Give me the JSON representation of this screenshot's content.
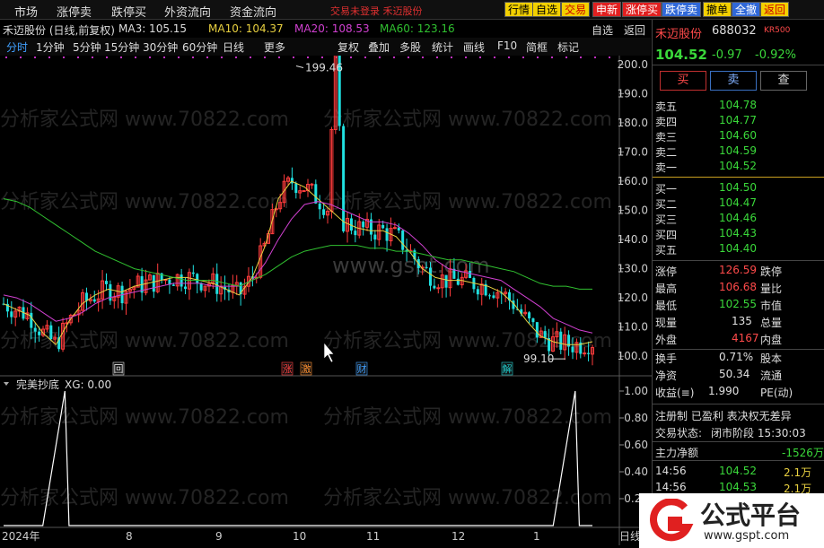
{
  "topbar": {
    "nav": [
      "市场",
      "涨停卖",
      "跌停买",
      "外资流向",
      "资金流向"
    ],
    "alert": "交易未登录  禾迈股份",
    "buttons": [
      {
        "label": "行情",
        "bg": "#f2d000",
        "fg": "#000"
      },
      {
        "label": "自选",
        "bg": "#f2d000",
        "fg": "#000"
      },
      {
        "label": "交易",
        "bg": "#f2d000",
        "fg": "#c00"
      },
      {
        "label": "申新",
        "bg": "#e02020",
        "fg": "#fff"
      },
      {
        "label": "涨停买",
        "bg": "#e02020",
        "fg": "#fff"
      },
      {
        "label": "跌停卖",
        "bg": "#3068d8",
        "fg": "#fff"
      },
      {
        "label": "撤单",
        "bg": "#f2d000",
        "fg": "#000"
      },
      {
        "label": "全撤",
        "bg": "#3068d8",
        "fg": "#fff"
      },
      {
        "label": "返回",
        "bg": "#f2d000",
        "fg": "#c00"
      }
    ]
  },
  "chart_header": {
    "title": "禾迈股份 (日线,前复权)",
    "ma3": "MA3: 105.15",
    "ma10": "MA10: 104.37",
    "ma20": "MA20: 108.53",
    "ma60": "MA60: 123.16",
    "right_tools": [
      "自选",
      "返回"
    ]
  },
  "periods": [
    "分时",
    "1分钟",
    "5分钟",
    "15分钟",
    "30分钟",
    "60分钟",
    "日线",
    "更多"
  ],
  "tools": [
    "复权",
    "叠加",
    "多股",
    "统计",
    "画线",
    "F10",
    "简框",
    "标记"
  ],
  "price_axis": [
    "200.0",
    "190.0",
    "180.0",
    "170.0",
    "160.0",
    "150.0",
    "140.0",
    "130.0",
    "120.0",
    "110.0",
    "100.0"
  ],
  "annotations": {
    "high": "199.46",
    "low": "99.10"
  },
  "event_marks": [
    "回",
    "涨",
    "激",
    "财",
    "解"
  ],
  "indicator": {
    "title": "完美抄底",
    "value": "XG: 0.00",
    "axis": [
      "1.00",
      "0.80",
      "0.60",
      "0.40",
      "0.20"
    ]
  },
  "x_axis": [
    "2024年",
    "8",
    "9",
    "10",
    "11",
    "12",
    "1",
    "日线"
  ],
  "colors": {
    "up": "#ff3c3c",
    "down": "#20e0e0",
    "ma3": "#ffffff",
    "ma10": "#e8d040",
    "ma20": "#d040d0",
    "ma60": "#30c030"
  },
  "chart_data": {
    "type": "line",
    "title": "禾迈股份 (日线,前复权)",
    "xlabel": "",
    "ylabel": "",
    "ylim": [
      97,
      203
    ],
    "x_ticks": [
      "2024年",
      "8",
      "9",
      "10",
      "11",
      "12",
      "1"
    ],
    "series": [
      {
        "name": "MA10",
        "values": [
          118,
          116,
          114,
          108,
          104,
          112,
          118,
          121,
          123,
          122,
          124,
          125,
          126,
          127,
          127,
          126,
          125,
          123,
          121,
          127,
          138,
          154,
          160,
          158,
          154,
          150,
          146,
          144,
          143,
          143,
          141,
          136,
          130,
          127,
          126,
          126,
          125,
          124,
          122,
          118,
          112,
          107,
          105,
          104,
          104,
          105
        ]
      },
      {
        "name": "MA20",
        "values": [
          121,
          120,
          118,
          115,
          112,
          113,
          115,
          118,
          120,
          121,
          122,
          123,
          124,
          125,
          125,
          125,
          124,
          124,
          124,
          126,
          132,
          140,
          147,
          152,
          153,
          152,
          150,
          148,
          146,
          146,
          145,
          142,
          138,
          133,
          130,
          129,
          128,
          127,
          126,
          123,
          120,
          117,
          113,
          111,
          109,
          108
        ]
      },
      {
        "name": "MA60",
        "values": [
          154,
          153,
          151,
          148,
          145,
          142,
          139,
          136,
          134,
          132,
          130,
          129,
          128,
          127,
          126,
          126,
          126,
          125,
          124,
          126,
          128,
          131,
          134,
          136,
          137,
          138,
          138,
          138,
          137,
          137,
          136,
          136,
          135,
          134,
          133,
          133,
          132,
          131,
          130,
          129,
          127,
          125,
          124,
          124,
          123,
          123
        ]
      },
      {
        "name": "完美抄底",
        "values": [
          0,
          0,
          0,
          0,
          1,
          0,
          0,
          0,
          0,
          0,
          0,
          0,
          0,
          0,
          0,
          0,
          0,
          0,
          0,
          0,
          0,
          0,
          0,
          0,
          0,
          0,
          0,
          0,
          0,
          0,
          0,
          0,
          0,
          0,
          0,
          0,
          0,
          0,
          0,
          0,
          0,
          0,
          0,
          1,
          0,
          0
        ]
      }
    ]
  },
  "quote": {
    "name": "禾迈股份",
    "code": "688032",
    "tag": "KR500",
    "price": "104.52",
    "change": "-0.97",
    "pct": "-0.92%",
    "buy": "买",
    "sell": "卖",
    "query": "查",
    "asks": [
      {
        "l": "卖五",
        "p": "104.78"
      },
      {
        "l": "卖四",
        "p": "104.77"
      },
      {
        "l": "卖三",
        "p": "104.60"
      },
      {
        "l": "卖二",
        "p": "104.59"
      },
      {
        "l": "卖一",
        "p": "104.52"
      }
    ],
    "bids": [
      {
        "l": "买一",
        "p": "104.50"
      },
      {
        "l": "买二",
        "p": "104.47"
      },
      {
        "l": "买三",
        "p": "104.46"
      },
      {
        "l": "买四",
        "p": "104.43"
      },
      {
        "l": "买五",
        "p": "104.40"
      }
    ],
    "stats": [
      {
        "l": "涨停",
        "v": "126.59",
        "l2": "跌停",
        "c": "#ff4a4a"
      },
      {
        "l": "最高",
        "v": "106.68",
        "l2": "量比",
        "c": "#ff4a4a"
      },
      {
        "l": "最低",
        "v": "102.55",
        "l2": "市值",
        "c": "#3ad83a"
      },
      {
        "l": "现量",
        "v": "135",
        "l2": "总量",
        "c": "#e0e0e0"
      },
      {
        "l": "外盘",
        "v": "4167",
        "l2": "内盘",
        "c": "#ff4a4a"
      }
    ],
    "stats2": [
      {
        "l": "换手",
        "v": "0.71%",
        "l2": "股本"
      },
      {
        "l": "净资",
        "v": "50.34",
        "l2": "流通"
      },
      {
        "l": "收益(≡)",
        "v": "1.990",
        "l2": "PE(动)"
      }
    ],
    "flags": "注册制 已盈利 表决权无差异",
    "status_label": "交易状态:",
    "status": "闭市阶段 15:30:03",
    "flow_label": "主力净额",
    "flow": "-1526万",
    "ticks": [
      {
        "t": "14:56",
        "p": "104.52",
        "v": "2.1万"
      },
      {
        "t": "14:56",
        "p": "104.53",
        "v": "2.1万"
      }
    ]
  },
  "watermarks": [
    "分析家公式网 www.70822.com",
    "www.gspt.com"
  ],
  "logo": {
    "text": "公式平台",
    "url": "www.gspt.com"
  }
}
